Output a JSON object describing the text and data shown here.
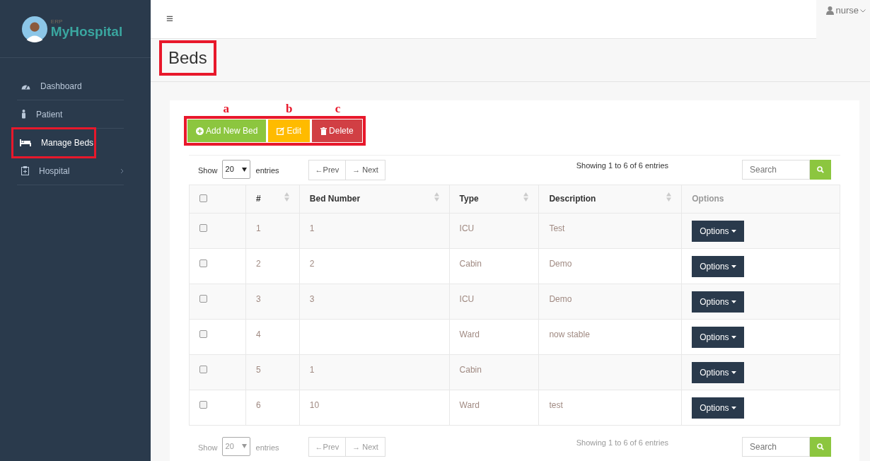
{
  "brand": {
    "small": "ERP",
    "name": "MyHospital"
  },
  "sidebar": {
    "items": [
      {
        "label": "Dashboard",
        "selected": false,
        "highlighted": false,
        "has_children": false
      },
      {
        "label": "Patient",
        "selected": false,
        "highlighted": false,
        "has_children": false
      },
      {
        "label": "Manage Beds",
        "selected": true,
        "highlighted": true,
        "has_children": false
      },
      {
        "label": "Hospital",
        "selected": false,
        "highlighted": false,
        "has_children": true
      }
    ]
  },
  "topbar": {
    "menu_icon": "≡",
    "user": "nurse"
  },
  "page": {
    "title": "Beds",
    "title_highlighted": true
  },
  "toolbar": {
    "highlighted": true,
    "buttons": [
      {
        "label": "Add New Bed",
        "annotation": "a",
        "kind": "add"
      },
      {
        "label": "Edit",
        "annotation": "b",
        "kind": "edit"
      },
      {
        "label": "Delete",
        "annotation": "c",
        "kind": "delete"
      }
    ]
  },
  "top_controls": {
    "show": "Show",
    "page_size": "20",
    "entries": "entries",
    "prev": "←Prev",
    "next": "→ Next",
    "info": "Showing 1 to 6 of 6 entries",
    "search_placeholder": "Search",
    "disabled": false
  },
  "table": {
    "select_all_checked": false,
    "columns": [
      {
        "label": "#",
        "sortable": true,
        "muted": false,
        "kind": "text"
      },
      {
        "label": "Bed Number",
        "sortable": true,
        "muted": false,
        "kind": "text"
      },
      {
        "label": "Type",
        "sortable": true,
        "muted": false,
        "kind": "text"
      },
      {
        "label": "Description",
        "sortable": true,
        "muted": false,
        "kind": "text"
      },
      {
        "label": "Options",
        "sortable": false,
        "muted": true,
        "kind": "action"
      }
    ],
    "rows": [
      {
        "checked": false,
        "cells": [
          "1",
          "1",
          "ICU",
          "Test",
          "Options"
        ]
      },
      {
        "checked": false,
        "cells": [
          "2",
          "2",
          "Cabin",
          "Demo",
          "Options"
        ]
      },
      {
        "checked": false,
        "cells": [
          "3",
          "3",
          "ICU",
          "Demo",
          "Options"
        ]
      },
      {
        "checked": false,
        "cells": [
          "4",
          "",
          "Ward",
          "now stable",
          "Options"
        ]
      },
      {
        "checked": false,
        "cells": [
          "5",
          "1",
          "Cabin",
          "",
          "Options"
        ]
      },
      {
        "checked": false,
        "cells": [
          "6",
          "10",
          "Ward",
          "test",
          "Options"
        ]
      }
    ]
  },
  "bottom_controls": {
    "show": "Show",
    "page_size": "20",
    "entries": "entries",
    "prev": "←Prev",
    "next": "→ Next",
    "info": "Showing 1 to 6 of 6 entries",
    "search_placeholder": "Search",
    "disabled": true
  }
}
